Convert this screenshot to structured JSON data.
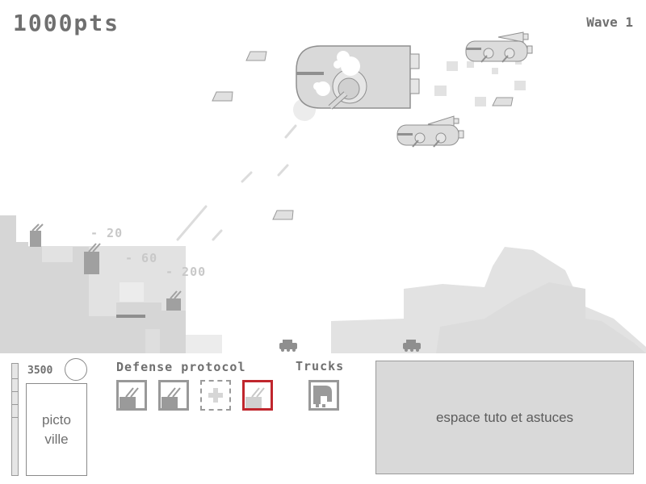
{
  "hud": {
    "score": "1000pts",
    "wave": "Wave 1"
  },
  "penalties": [
    "- 20",
    "- 60",
    "- 200"
  ],
  "panel": {
    "money": "3500",
    "city_name": "picto\nville",
    "defense_title": "Defense protocol",
    "trucks_title": "Trucks",
    "tips_text": "espace tuto et astuces",
    "defense_slots": [
      {
        "state": "filled",
        "icon": "turret-icon"
      },
      {
        "state": "filled",
        "icon": "turret-icon"
      },
      {
        "state": "empty",
        "icon": "plus-icon"
      },
      {
        "state": "selected",
        "icon": "turret-icon"
      }
    ],
    "truck_slots": [
      {
        "icon": "truck-icon"
      }
    ]
  },
  "colors": {
    "selected_border": "#c0262d",
    "building_light": "#e2e2e2",
    "building_mid": "#d6d6d6",
    "structure": "#8f8f8f"
  }
}
